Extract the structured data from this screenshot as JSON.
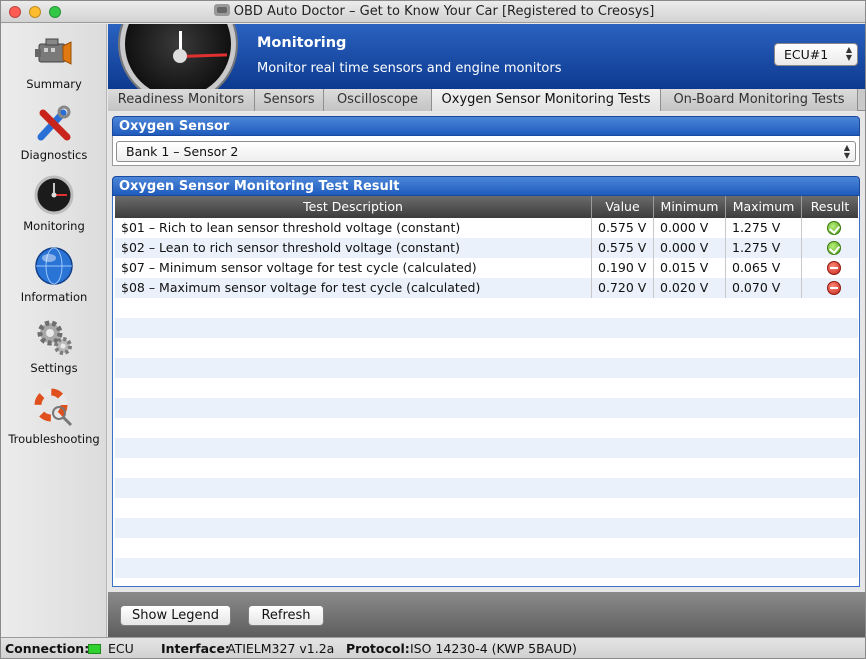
{
  "window": {
    "title": "OBD Auto Doctor – Get to Know Your Car [Registered to Creosys]"
  },
  "sidebar": {
    "items": [
      {
        "label": "Summary",
        "icon": "engine-icon"
      },
      {
        "label": "Diagnostics",
        "icon": "tools-icon"
      },
      {
        "label": "Monitoring",
        "icon": "gauge-icon"
      },
      {
        "label": "Information",
        "icon": "globe-icon"
      },
      {
        "label": "Settings",
        "icon": "gear-icon"
      },
      {
        "label": "Troubleshooting",
        "icon": "lifebuoy-icon"
      }
    ]
  },
  "header": {
    "title": "Monitoring",
    "subtitle": "Monitor real time sensors and engine monitors",
    "ecu": "ECU#1"
  },
  "tabs": [
    {
      "label": "Readiness Monitors"
    },
    {
      "label": "Sensors"
    },
    {
      "label": "Oscilloscope"
    },
    {
      "label": "Oxygen Sensor Monitoring Tests"
    },
    {
      "label": "On-Board Monitoring Tests"
    }
  ],
  "oxygen_sensor": {
    "heading": "Oxygen Sensor",
    "selected": "Bank 1 – Sensor 2"
  },
  "results": {
    "heading": "Oxygen Sensor Monitoring Test Result",
    "columns": [
      "Test Description",
      "Value",
      "Minimum",
      "Maximum",
      "Result"
    ],
    "rows": [
      {
        "desc": "$01 – Rich to lean sensor threshold voltage (constant)",
        "value": "0.575 V",
        "min": "0.000 V",
        "max": "1.275 V",
        "result": "pass"
      },
      {
        "desc": "$02 – Lean to rich sensor threshold voltage (constant)",
        "value": "0.575 V",
        "min": "0.000 V",
        "max": "1.275 V",
        "result": "pass"
      },
      {
        "desc": "$07 – Minimum sensor voltage for test cycle (calculated)",
        "value": "0.190 V",
        "min": "0.015 V",
        "max": "0.065 V",
        "result": "fail"
      },
      {
        "desc": "$08 – Maximum sensor voltage for test cycle (calculated)",
        "value": "0.720 V",
        "min": "0.020 V",
        "max": "0.070 V",
        "result": "fail"
      }
    ]
  },
  "buttons": {
    "legend": "Show Legend",
    "refresh": "Refresh"
  },
  "status": {
    "connection_label": "Connection:",
    "connection_value": "ECU",
    "interface_label": "Interface:",
    "interface_value": "ATIELM327 v1.2a",
    "protocol_label": "Protocol:",
    "protocol_value": "ISO 14230-4 (KWP 5BAUD)"
  },
  "colors": {
    "header_blue": "#1f4fa8",
    "connection_led": "#2fd12f",
    "pass": "#4d9a16",
    "fail": "#c2261a"
  }
}
